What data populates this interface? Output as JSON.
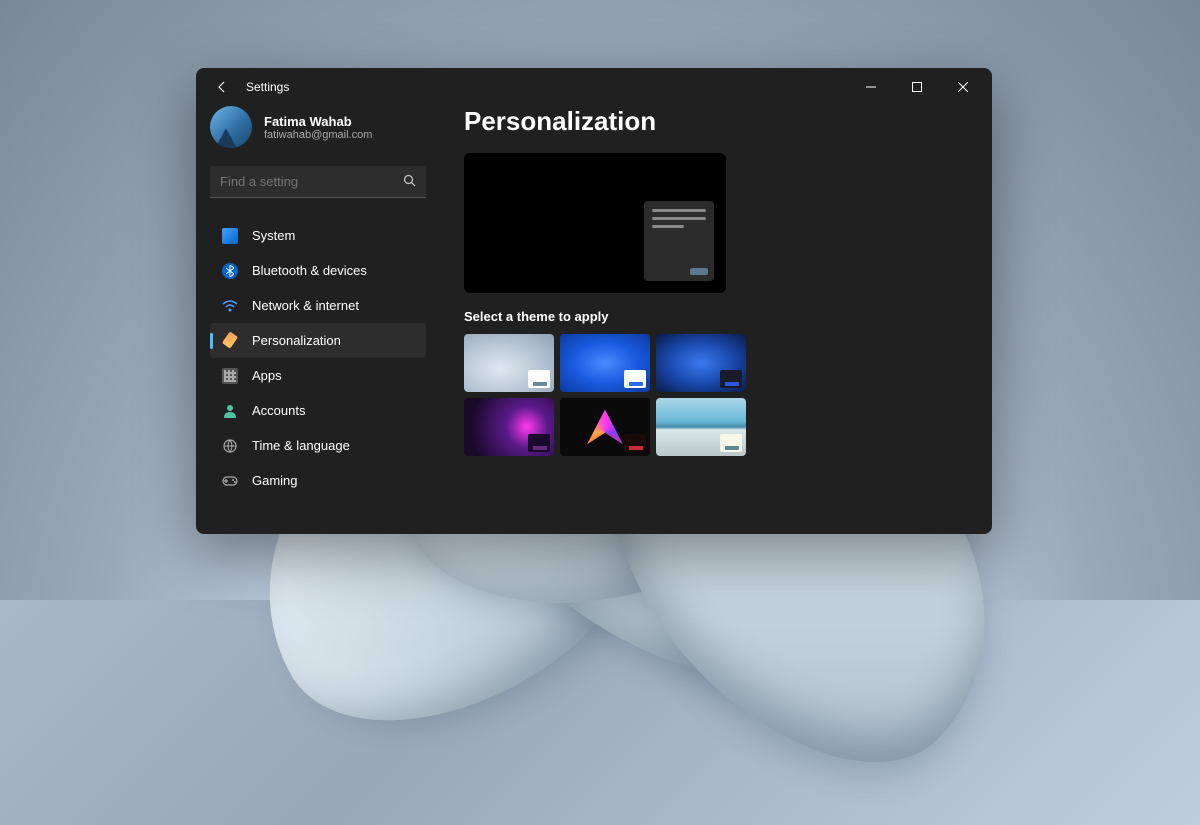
{
  "window": {
    "title": "Settings"
  },
  "user": {
    "name": "Fatima Wahab",
    "email": "fatiwahab@gmail.com"
  },
  "search": {
    "placeholder": "Find a setting"
  },
  "sidebar": {
    "items": [
      {
        "label": "System",
        "icon": "system"
      },
      {
        "label": "Bluetooth & devices",
        "icon": "bluetooth"
      },
      {
        "label": "Network & internet",
        "icon": "network"
      },
      {
        "label": "Personalization",
        "icon": "personalization",
        "active": true
      },
      {
        "label": "Apps",
        "icon": "apps"
      },
      {
        "label": "Accounts",
        "icon": "accounts"
      },
      {
        "label": "Time & language",
        "icon": "time"
      },
      {
        "label": "Gaming",
        "icon": "gaming"
      }
    ]
  },
  "page": {
    "title": "Personalization",
    "theme_prompt": "Select a theme to apply",
    "themes": [
      {
        "id": "light-bloom"
      },
      {
        "id": "blue-bloom-light"
      },
      {
        "id": "blue-bloom-dark"
      },
      {
        "id": "glow"
      },
      {
        "id": "captured-motion"
      },
      {
        "id": "sunrise"
      }
    ]
  }
}
